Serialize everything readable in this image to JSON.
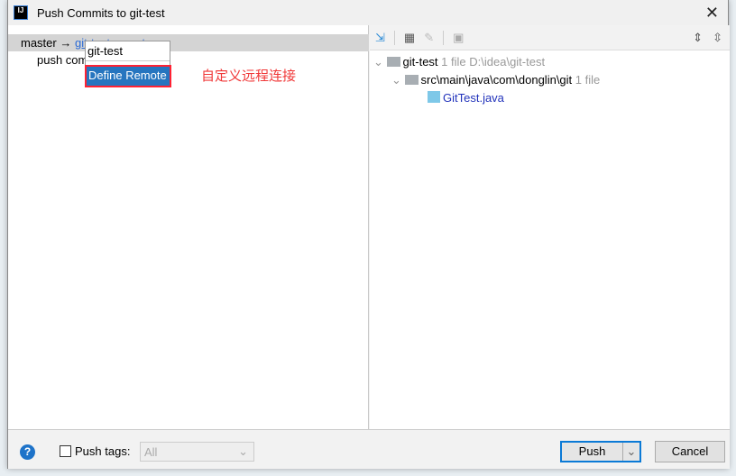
{
  "window": {
    "title": "Push Commits to git-test",
    "logo": "IJ"
  },
  "left": {
    "branch": "master →",
    "remote_link": "git-test : master",
    "push_commits": "push com",
    "popup": {
      "items": [
        "git-test",
        "Define Remote"
      ]
    },
    "annotation": "自定义远程连接"
  },
  "toolbar": {
    "icons": [
      "arrows-collapse-icon",
      "group-by-icon",
      "edit-icon",
      "diff-icon",
      "expand-all-icon",
      "collapse-all-icon"
    ]
  },
  "tree": {
    "root": {
      "name": "git-test",
      "count": "1 file",
      "path": "D:\\idea\\git-test"
    },
    "folder": {
      "name": "src\\main\\java\\com\\donglin\\git",
      "count": "1 file"
    },
    "file": "GitTest.java"
  },
  "bottom": {
    "push_tags_label": "Push tags:",
    "tags_select": "All",
    "push_label": "Push",
    "cancel_label": "Cancel"
  }
}
